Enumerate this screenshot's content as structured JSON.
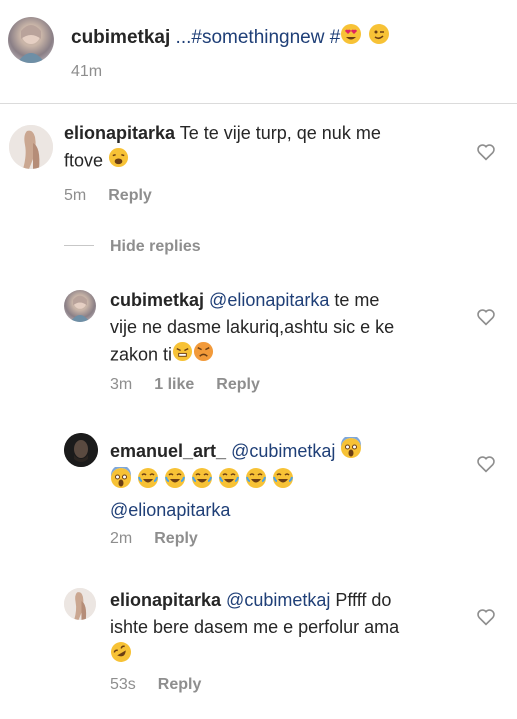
{
  "post": {
    "username": "cubimetkaj",
    "caption": " ...#somethingnew #",
    "time": "41m"
  },
  "comments": [
    {
      "username": "elionapitarka",
      "text_line1": " Te te vije turp, qe nuk me",
      "text_line2": "ftove ",
      "time": "5m",
      "reply": "Reply"
    }
  ],
  "hide_replies": "Hide replies",
  "replies": [
    {
      "username": "cubimetkaj",
      "mention": " @elionapitarka",
      "text_line1": " te me",
      "text_line2": "vije ne dasme lakuriq,ashtu sic e ke",
      "text_line3": "zakon ti",
      "time": "3m",
      "likes": "1 like",
      "reply": "Reply"
    },
    {
      "username": "emanuel_art_",
      "mention": " @cubimetkaj",
      "mention2": "@elionapitarka",
      "time": "2m",
      "reply": "Reply"
    },
    {
      "username": "elionapitarka",
      "mention": " @cubimetkaj",
      "text_line1": " Pffff do",
      "text_line2": "ishte bere dasem me e perfolur ama",
      "time": "53s",
      "reply": "Reply"
    }
  ],
  "colors": {
    "mention": "#1f3f77",
    "meta": "#8e8e8e",
    "emoji_yellow": "#f7c236"
  },
  "icons": [
    "heart-eyes-emoji",
    "wink-emoji",
    "weary-emoji",
    "steam-nose-emoji",
    "angry-emoji",
    "scream-emoji",
    "joy-emoji",
    "rofl-emoji",
    "heart-outline-icon"
  ]
}
